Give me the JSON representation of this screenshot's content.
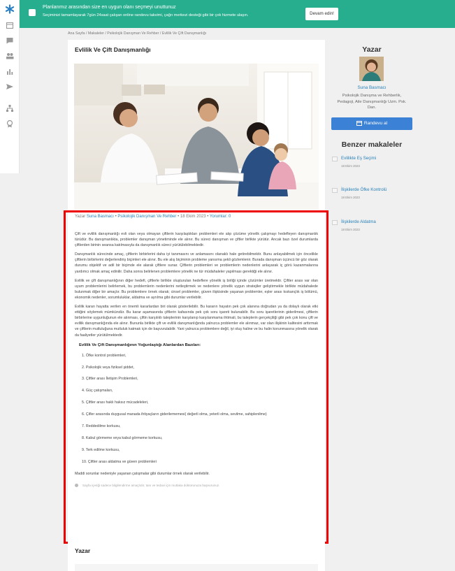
{
  "banner": {
    "title": "Planlarımız arasından size en uygun olanı seçmeyi unuttunuz",
    "subtitle": "Seçiminizi tamamlayarak 7gün 24saat çalışan online randevu takvimi, çağrı merkezi desteği gibi bir çok hizmete ulaşın.",
    "button": "Devam edin!"
  },
  "breadcrumb": "Ana Sayfa / Makaleler / Psikolojik Danışman Ve Rehber / Evlilik Ve Çift Danışmanlığı",
  "article": {
    "title": "Evlilik Ve Çift Danışmanlığı",
    "meta": {
      "prefix": "Yazar ",
      "author": "Suna Basmacı",
      "sep1": " • ",
      "category": "Psikolojik Danışman Ve Rehber",
      "sep2": " • 18 Ekim 2023 • ",
      "comments": "Yorumlar: 0"
    },
    "paragraphs": [
      "Çift ve evlilik danışmanlığı evli olan veya olmayan çiftlerin karşılaştıkları problemleri ele alıp çözüme yönelik çalışmayı hedefleyen danışmanlık türüdür. Bu danışmanlıkta, problemler danışman yönetiminde ele alınır. Bu süreci danışman ve çiftler birlikte yürütür. Ancak bazı özel durumlarda çiftlerden birinin seansa katılmasıyla da danışmanlık süreci yürütülebilmektedir.",
      "Danışmanlık sürecinde amaç, çiftlerin birbirlerini daha iyi tanımasını ve anlamasını olanaklı hale getirebilmektir. Bunu anlayabilmek için öncelikle çiftlerin birbirlerini değerlendiriş biçimleri ele alınır. Bu ele alış biçiminin probleme yansıma şekli gözlemlenir. Burada danışman üçüncü bir göz olarak durumu objektif ve adil bir biçimde ele alarak çiftlere sunar. Çiftlerin problemleri ve problemlerin nedenlerini anlayarak iç görü kazanmalarına yardımcı olmak amaç edinilir. Daha sonra belirlenen problemlere yönelik ne tür müdahaleler yapılması gerektiği ele alınır.",
      "Evlilik ve çift danışmanlığının diğer hedefi, çiftlerle birlikte oluşturulan hedeflere yönelik iş birliği içinde çözümler üretmektir. Çiftler arası var olan uyum problemlerini belirlemek, bu problemlerin nedenlerini netleştirmek ve nedenlere yönelik uygun stratejiler geliştirmekle birlikte müdahalede bulunmak diğer bir amaçtır. Bu problemlere örnek olarak; cinsel problemler, güven ilişkisinde yaşanan problemler, eşler arası kıskançlık iş bölümü, ekonomik nedenler, sorumluluklar, aldatma ve ayrılma gibi durumlar verilebilir.",
      "Evlilik kararı hayatta verilen en önemli kararlardan biri olarak gösterilebilir. Bu kararın hayatın pek çok alanına doğrudan ya da dolaylı olarak etki ettiğini söylemek mümkündür. Bu karar aşamasında çiftlerin kafasında pek çok soru işareti bulunabilir. Bu soru işaretlerinin giderilmesi, çiftlerin birbirlerine uygunluğunun ele alınması, çiftin karşılıklı taleplerinin karşılanıp karşılanmama ihtimali, bu taleplerin gerçekçiliği gibi pek çok konu çift ve evlilik danışmanlığında ele alınır. Bununla birlikte çift ve evlilik danışmanlığında yalnızca problemler ele alınmaz, var olan ilişkinin kalitesini arttırmak ve çiftlerin mutluluğuna mutluluk katmak için de başvurulabilir. Yani yalnızca problemlere değil, iyi oluş haline ve bu halin korunmasına yönelik olarak da faaliyetler yürütülmektedir."
    ],
    "section_heading": "Evlilik Ve Çift Danışmanlığının Yoğunlaştığı Alanlardan Bazıları:",
    "list": [
      "1. Öfke kontrol problemleri,",
      "2. Psikolojik veya fiziksel şiddet,",
      "3. Çiftler arası İletişim Problemleri,",
      "4. Güç çatışmaları,",
      "5. Çiftler arası haklı haksız mücadeleleri,",
      "6. Çifler arasında duygusal manada ihtiyaçların giderilememesi( değerli olma, yeterli olma, sevilme, sahiplenilme)",
      "7. Reddedilme korkusu,",
      "8. Kabul görmeme veya kabul görmeme korkusu,",
      "9. Terk edilme korkusu,",
      "10. Çiftler arası aldatma ve güven problemleri"
    ],
    "closing": "Maddi sorunlar nedeniyle yaşanan çatışmalar gibi durumlar örnek olarak verilebilir.",
    "note": "Sayfa içeriği sadece bilgilendirme amaçlıdır, tanı ve tedavi için mutlaka doktorunuza başvurunuz."
  },
  "author_section": {
    "title": "Yazar"
  },
  "sidebar_right": {
    "title": "Yazar",
    "author_name": "Suna Basmacı",
    "author_desc": "Psikolojik Danışma ve Rehberlik, Pedagoji, Aile Danışmanlığı Uzm. Psk. Dan.",
    "button": "Randevu al",
    "similar_title": "Benzer makaleler",
    "similar": [
      {
        "title": "Evlilikte Eş Seçimi",
        "date": "18 Ekim 2023"
      },
      {
        "title": "İlişkilerde Öfke Kontrolü",
        "date": "18 Ekim 2023"
      },
      {
        "title": "İlişkilerde Aldatma",
        "date": "18 Ekim 2023"
      }
    ]
  },
  "nav_icons": [
    "logo-icon",
    "calendar-icon",
    "message-icon",
    "users-icon",
    "stats-icon",
    "send-icon",
    "org-icon",
    "badge-icon"
  ],
  "colors": {
    "accent": "#27ae8e",
    "link": "#2980b9",
    "button": "#3b82d6",
    "highlight": "#ee0000"
  }
}
